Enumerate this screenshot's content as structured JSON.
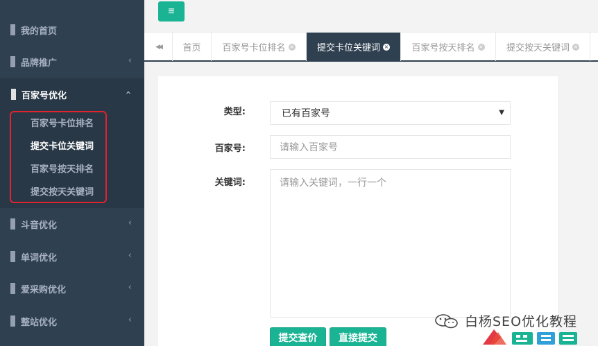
{
  "sidebar": {
    "items": [
      {
        "label": "我的首页",
        "has_arrow": false
      },
      {
        "label": "品牌推广",
        "has_arrow": true
      },
      {
        "label": "百家号优化",
        "has_arrow": true,
        "expanded": true
      },
      {
        "label": "斗音优化",
        "has_arrow": true
      },
      {
        "label": "单词优化",
        "has_arrow": true
      },
      {
        "label": "爱采购优化",
        "has_arrow": true
      },
      {
        "label": "整站优化",
        "has_arrow": true
      }
    ],
    "submenu": [
      "百家号卡位排名",
      "提交卡位关键词",
      "百家号按天排名",
      "提交按天关键词"
    ],
    "arrow_glyph": "‹"
  },
  "topbar": {
    "menu_icon": "hamburger-icon",
    "menu_glyph": "≡"
  },
  "tabs": {
    "back_glyph": "◀◀",
    "items": [
      {
        "label": "首页",
        "closable": false
      },
      {
        "label": "百家号卡位排名",
        "closable": true
      },
      {
        "label": "提交卡位关键词",
        "closable": true,
        "active": true
      },
      {
        "label": "百家号按天排名",
        "closable": true
      },
      {
        "label": "提交按天关键词",
        "closable": true
      }
    ],
    "close_glyph": "×"
  },
  "form": {
    "type_label": "类型:",
    "type_value": "已有百家号",
    "baijiahao_label": "百家号:",
    "baijiahao_placeholder": "请输入百家号",
    "keywords_label": "关键词:",
    "keywords_placeholder": "请输入关键词，一行一个",
    "submit_query_button": "提交查价",
    "direct_submit_button": "直接提交"
  },
  "watermark": {
    "text": "白杨SEO优化教程"
  },
  "colors": {
    "sidebar": "#2f4050",
    "accent": "#1ab394",
    "highlight_border": "#e0232f"
  }
}
